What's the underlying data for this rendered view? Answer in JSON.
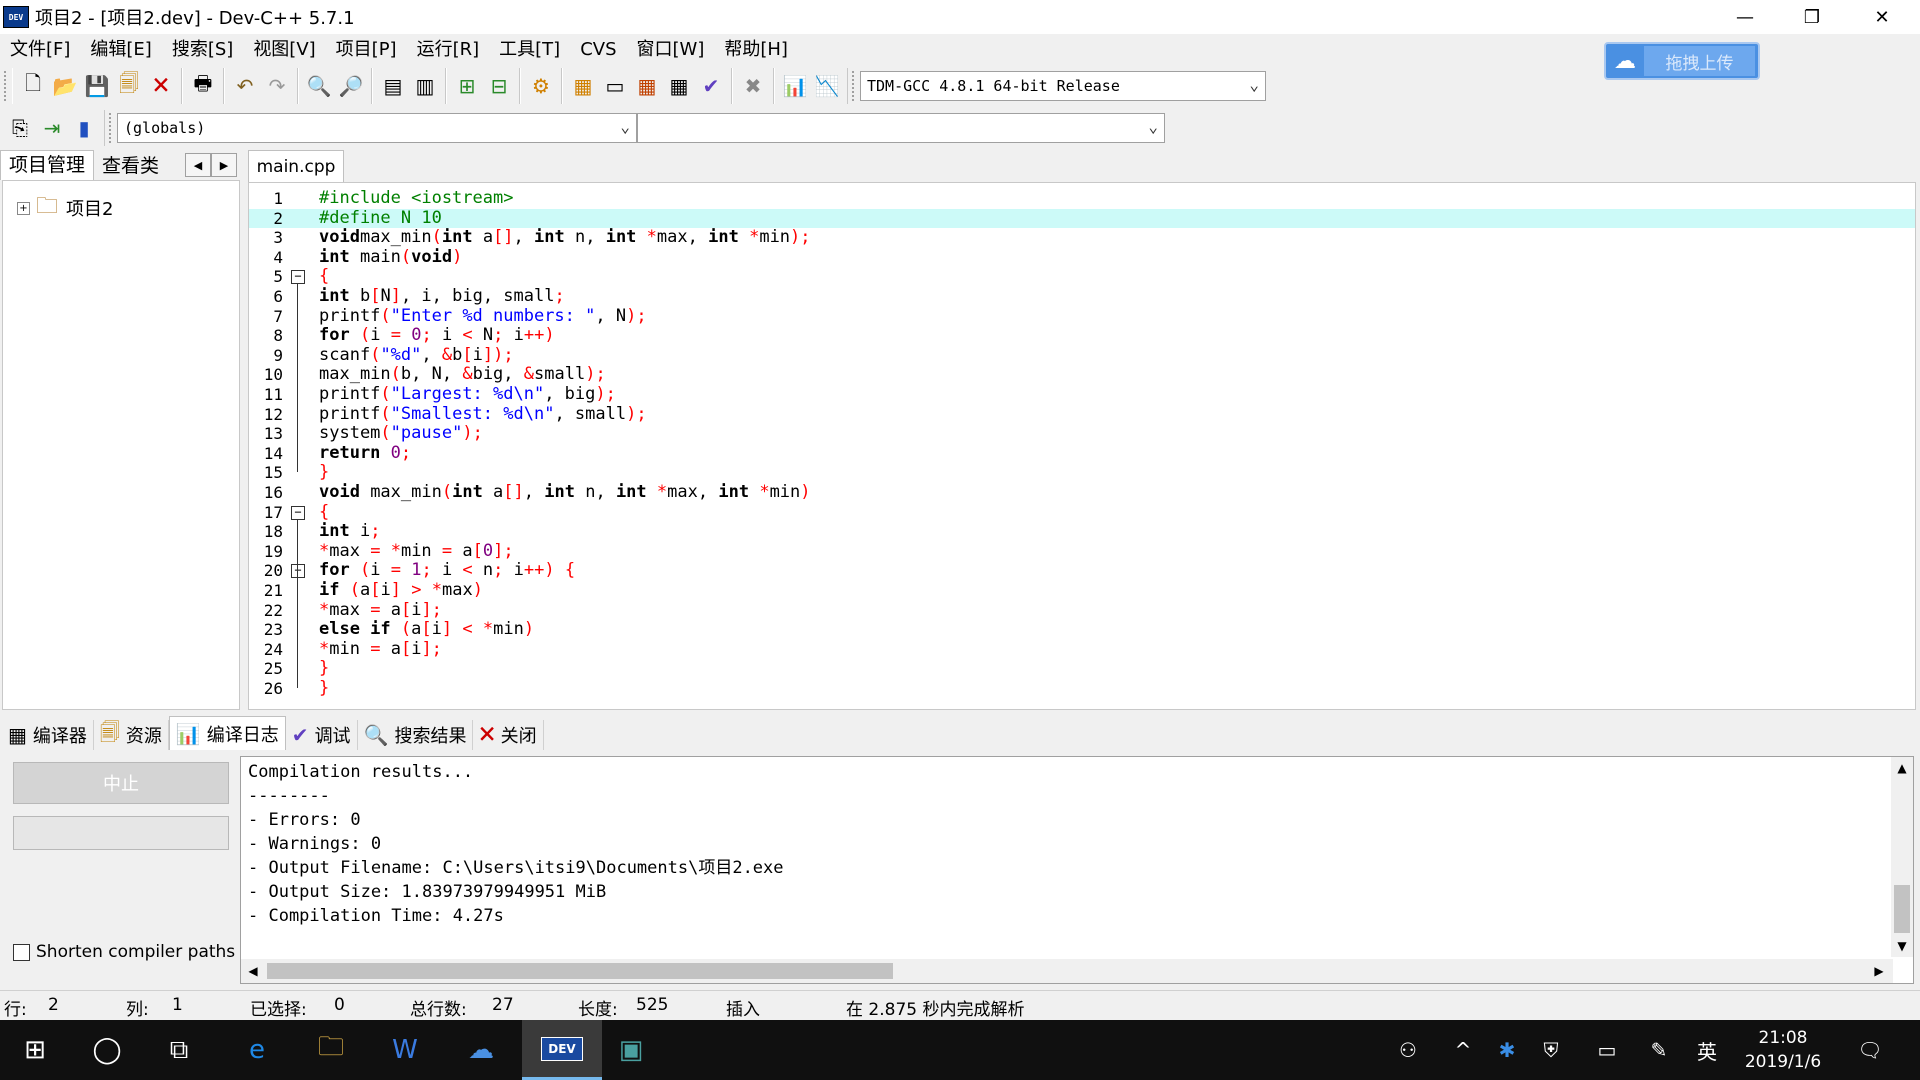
{
  "window": {
    "title": "项目2 - [项目2.dev] - Dev-C++ 5.7.1",
    "icon_label": "DEV",
    "minimize": "—",
    "restore": "❐",
    "close": "✕"
  },
  "menu": [
    "文件[F]",
    "编辑[E]",
    "搜索[S]",
    "视图[V]",
    "项目[P]",
    "运行[R]",
    "工具[T]",
    "CVS",
    "窗口[W]",
    "帮助[H]"
  ],
  "cloud_upload": {
    "label": "拖拽上传",
    "icon": "baidu-cloud-icon"
  },
  "toolbar": {
    "compiler_select": "TDM-GCC 4.8.1 64-bit Release",
    "scope_select": "(globals)",
    "function_select": ""
  },
  "left_panel": {
    "tabs": [
      "项目管理",
      "查看类"
    ],
    "tree_expander": "+",
    "tree_root": "项目2",
    "nav_prev": "◀",
    "nav_next": "▶"
  },
  "editor": {
    "tab": "main.cpp",
    "highlighted_line": 2
  },
  "bottom_tabs": [
    {
      "label": "编译器",
      "icon": "compiler-icon"
    },
    {
      "label": "资源",
      "icon": "resources-icon"
    },
    {
      "label": "编译日志",
      "icon": "compile-log-icon"
    },
    {
      "label": "调试",
      "icon": "debug-icon"
    },
    {
      "label": "搜索结果",
      "icon": "search-results-icon"
    },
    {
      "label": "关闭",
      "icon": "close-panel-icon"
    }
  ],
  "compile": {
    "abort_label": "中止",
    "shorten_label": "Shorten compiler paths",
    "log": [
      "Compilation results...",
      "--------",
      "- Errors: 0",
      "- Warnings: 0",
      "- Output Filename: C:\\Users\\itsi9\\Documents\\项目2.exe",
      "- Output Size: 1.83973979949951 MiB",
      "- Compilation Time: 4.27s"
    ]
  },
  "status": {
    "row_label": "行:",
    "row": "2",
    "col_label": "列:",
    "col": "1",
    "sel_label": "已选择:",
    "sel": "0",
    "lines_label": "总行数:",
    "lines": "27",
    "len_label": "长度:",
    "len": "525",
    "mode": "插入",
    "parse": "在 2.875 秒内完成解析"
  },
  "taskbar": {
    "clock_time": "21:08",
    "clock_date": "2019/1/6",
    "ime": "英",
    "dev_label": "DEV"
  }
}
